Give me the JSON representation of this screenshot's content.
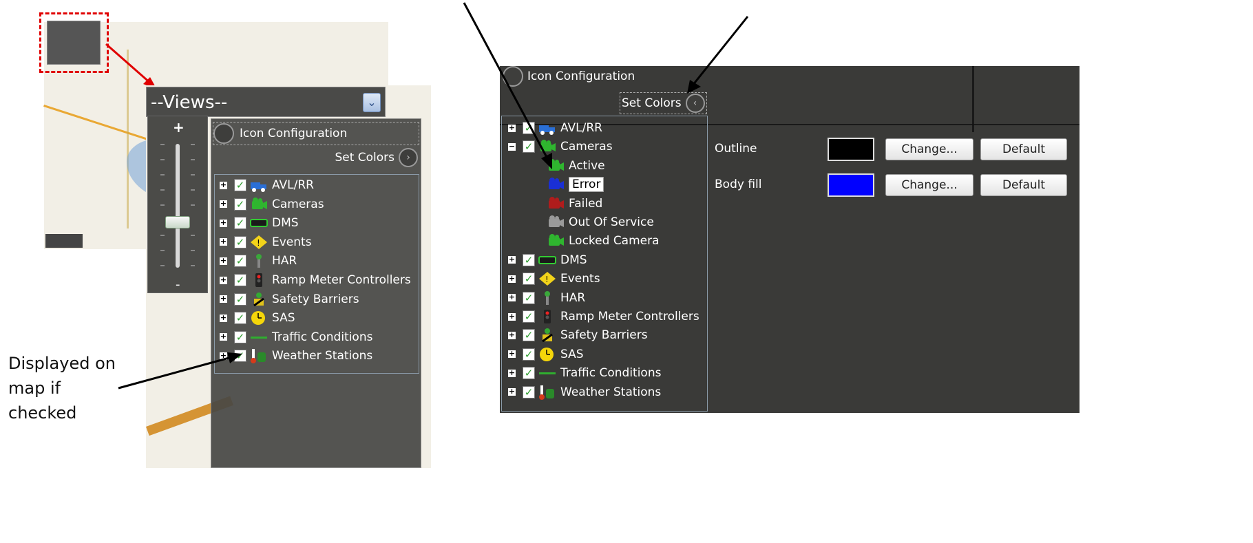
{
  "left": {
    "views_label": "--Views--",
    "zoom_plus": "+",
    "zoom_minus": "-",
    "icon_config_label": "Icon Configuration",
    "set_colors_label": "Set Colors",
    "layers": [
      {
        "label": "AVL/RR",
        "icon": "truck-icon",
        "color": "#2a6fd6"
      },
      {
        "label": "Cameras",
        "icon": "camera-icon",
        "color": "#2fb52f"
      },
      {
        "label": "DMS",
        "icon": "sign-icon",
        "color": "#1a1a1a"
      },
      {
        "label": "Events",
        "icon": "warning-icon",
        "color": "#f2d31a"
      },
      {
        "label": "HAR",
        "icon": "radio-tower-icon",
        "color": "#3aa83a"
      },
      {
        "label": "Ramp Meter Controllers",
        "icon": "traffic-light-icon",
        "color": "#222222"
      },
      {
        "label": "Safety Barriers",
        "icon": "barrier-icon",
        "color": "#e0c21a"
      },
      {
        "label": "SAS",
        "icon": "clock-icon",
        "color": "#f5d60a"
      },
      {
        "label": "Traffic Conditions",
        "icon": "line-icon",
        "color": "#2fae2f"
      },
      {
        "label": "Weather Stations",
        "icon": "thermometer-icon",
        "color": "#d63a1a"
      }
    ],
    "callout": [
      "Displayed on",
      "map if",
      "checked"
    ]
  },
  "right": {
    "icon_config_label": "Icon Configuration",
    "set_colors_label": "Set Colors",
    "layers": [
      {
        "label": "AVL/RR",
        "icon": "truck-icon",
        "color": "#2a6fd6",
        "expand": "+"
      },
      {
        "label": "Cameras",
        "icon": "camera-icon",
        "color": "#2fb52f",
        "expand": "−"
      },
      {
        "label": "Active",
        "icon": "camera-active-icon",
        "color": "#2fb52f",
        "child": true
      },
      {
        "label": "Error",
        "icon": "camera-error-icon",
        "color": "#1a2fd6",
        "child": true,
        "selected": true
      },
      {
        "label": "Failed",
        "icon": "camera-failed-icon",
        "color": "#b01c1c",
        "child": true
      },
      {
        "label": "Out Of Service",
        "icon": "camera-oos-icon",
        "color": "#9a9a9a",
        "child": true
      },
      {
        "label": "Locked Camera",
        "icon": "camera-locked-icon",
        "color": "#2fb52f",
        "child": true
      },
      {
        "label": "DMS",
        "icon": "sign-icon",
        "color": "#1a1a1a",
        "expand": "+"
      },
      {
        "label": "Events",
        "icon": "warning-icon",
        "color": "#f2d31a",
        "expand": "+"
      },
      {
        "label": "HAR",
        "icon": "radio-tower-icon",
        "color": "#3aa83a",
        "expand": "+"
      },
      {
        "label": "Ramp Meter Controllers",
        "icon": "traffic-light-icon",
        "color": "#222222",
        "expand": "+"
      },
      {
        "label": "Safety Barriers",
        "icon": "barrier-icon",
        "color": "#e0c21a",
        "expand": "+"
      },
      {
        "label": "SAS",
        "icon": "clock-icon",
        "color": "#f5d60a",
        "expand": "+"
      },
      {
        "label": "Traffic Conditions",
        "icon": "line-icon",
        "color": "#2fae2f",
        "expand": "+"
      },
      {
        "label": "Weather Stations",
        "icon": "thermometer-icon",
        "color": "#d63a1a",
        "expand": "+"
      }
    ],
    "color_settings": [
      {
        "label": "Outline",
        "swatch": "#000000",
        "change": "Change...",
        "default": "Default"
      },
      {
        "label": "Body fill",
        "swatch": "#0000ff",
        "change": "Change...",
        "default": "Default"
      }
    ]
  }
}
